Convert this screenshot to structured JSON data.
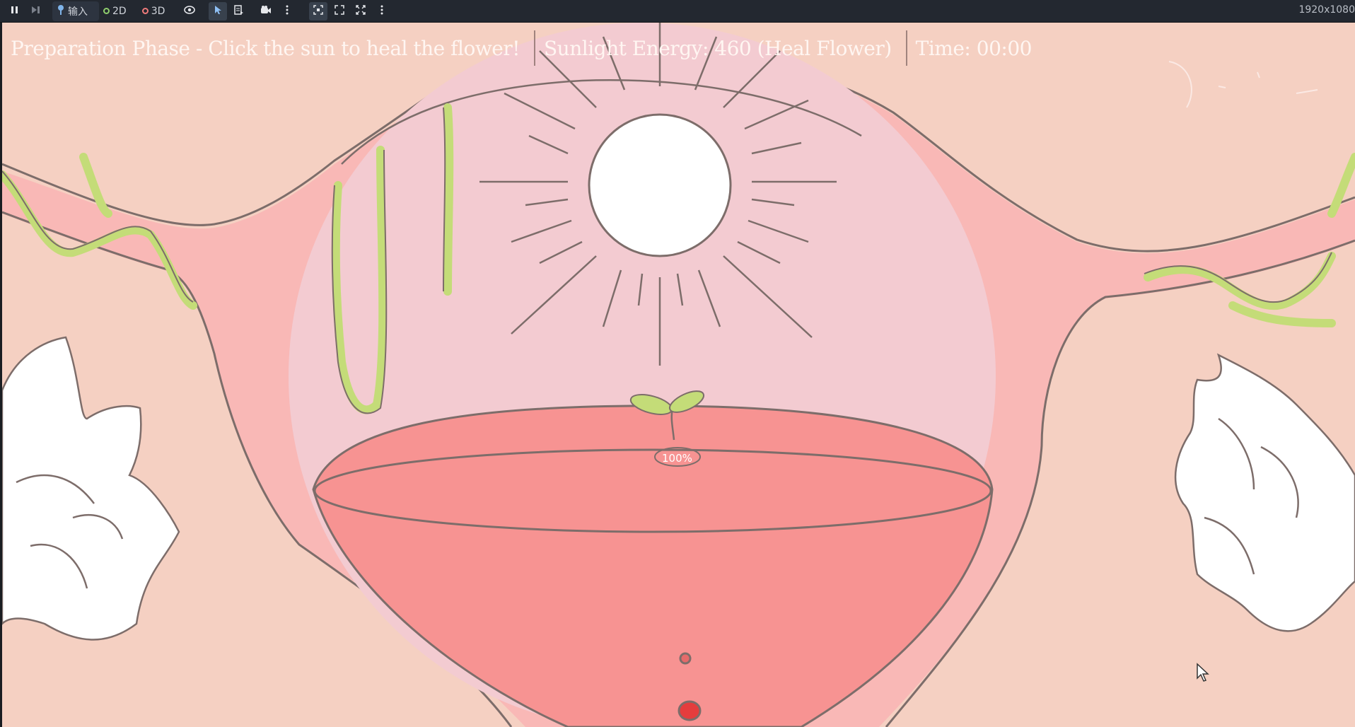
{
  "toolbar": {
    "input_label": "输入",
    "mode_2d": "2D",
    "mode_3d": "3D",
    "resolution": "1920x1080",
    "icons": [
      "pause-icon",
      "step-icon",
      "input-icon",
      "eye-icon",
      "select-arrow-icon",
      "list-icon",
      "camera-icon",
      "kebab-icon",
      "focus-icon",
      "expand-icon",
      "fullscreen-icon",
      "kebab-icon"
    ]
  },
  "hud": {
    "phase_text": "Preparation Phase - Click the sun to heal the flower!",
    "energy_text": "Sunlight Energy: 460 (Heal Flower)",
    "time_text": "Time: 00:00"
  },
  "flower": {
    "health_text": "100%",
    "health": 1.0
  },
  "colors": {
    "background": "#f5d0c2",
    "uterus_pink": "#f9b8b6",
    "inner_circle": "#f3cbd1",
    "bowl_red": "#f79392",
    "outline": "#7d6d6a",
    "vine_green": "#c4dc78",
    "sun_white": "#ffffff"
  }
}
